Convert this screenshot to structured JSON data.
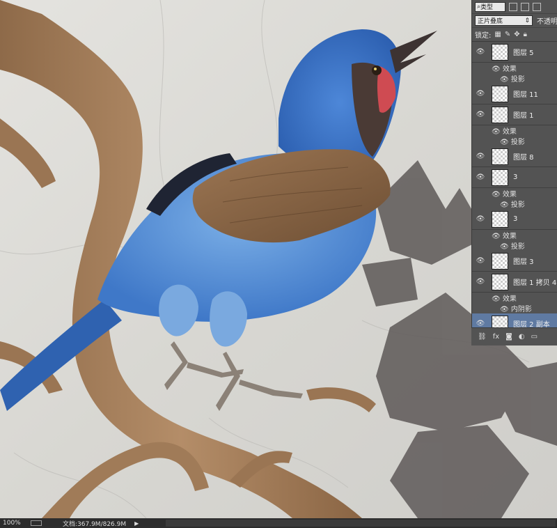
{
  "colors": {
    "bird_blue": "#3f78c8",
    "wing_brown": "#8a6646",
    "branch": "#a57f5a",
    "panel_bg": "#535353",
    "selected_row": "#5f7aa2"
  },
  "layers_panel": {
    "filter_label": "类型",
    "blend_mode": "正片叠底",
    "opacity_label": "不透明",
    "lock_label": "锁定:",
    "rows": [
      {
        "kind": "layer",
        "name": "图层 5",
        "selected": false
      },
      {
        "kind": "effects",
        "label": "效果"
      },
      {
        "kind": "effect",
        "label": "投影"
      },
      {
        "kind": "layer",
        "name": "图层 11",
        "selected": false
      },
      {
        "kind": "layer",
        "name": "图层 1",
        "selected": false
      },
      {
        "kind": "effects",
        "label": "效果"
      },
      {
        "kind": "effect",
        "label": "投影"
      },
      {
        "kind": "layer",
        "name": "图层 8",
        "selected": false
      },
      {
        "kind": "layer",
        "name": "3",
        "selected": false
      },
      {
        "kind": "effects",
        "label": "效果"
      },
      {
        "kind": "effect",
        "label": "投影"
      },
      {
        "kind": "layer",
        "name": "3",
        "selected": false
      },
      {
        "kind": "effects",
        "label": "效果"
      },
      {
        "kind": "effect",
        "label": "投影"
      },
      {
        "kind": "layer",
        "name": "图层 3",
        "selected": false
      },
      {
        "kind": "layer",
        "name": "图层 1 拷贝 4",
        "selected": false
      },
      {
        "kind": "effects",
        "label": "效果"
      },
      {
        "kind": "effect",
        "label": "内阴影"
      },
      {
        "kind": "layer",
        "name": "图层 2 副本",
        "selected": true
      }
    ],
    "footer_icons": [
      "link-icon",
      "fx-icon",
      "mask-icon",
      "adjustment-icon",
      "folder-icon"
    ]
  },
  "status_bar": {
    "zoom": "100%",
    "doc_info": "文档:367.9M/826.9M"
  }
}
